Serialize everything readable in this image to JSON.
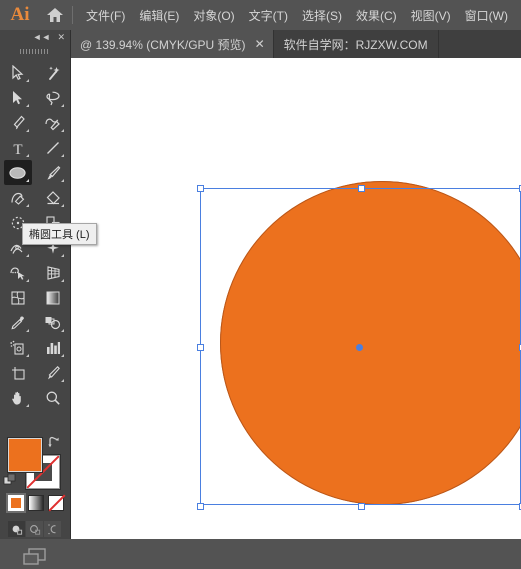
{
  "app": {
    "logo_text": "Ai",
    "home_icon": "home-icon",
    "accent_color": "#e98a3c",
    "shape_fill_color": "#ec711e",
    "selection_color": "#4a7fe0"
  },
  "menubar": {
    "items": [
      {
        "label": "文件(F)",
        "name": "menu-file"
      },
      {
        "label": "编辑(E)",
        "name": "menu-edit"
      },
      {
        "label": "对象(O)",
        "name": "menu-object"
      },
      {
        "label": "文字(T)",
        "name": "menu-type"
      },
      {
        "label": "选择(S)",
        "name": "menu-select"
      },
      {
        "label": "效果(C)",
        "name": "menu-effect"
      },
      {
        "label": "视图(V)",
        "name": "menu-view"
      },
      {
        "label": "窗口(W)",
        "name": "menu-window"
      }
    ]
  },
  "tabbar": {
    "document_tab": {
      "label": "@ 139.94% (CMYK/GPU 预览)",
      "zoom_level": "139.94%",
      "color_mode": "CMYK",
      "preview_mode": "GPU 预览",
      "close_label": "✕"
    },
    "watermark_tab": {
      "label": "软件自学网：RJZXW.COM"
    }
  },
  "toolpanel": {
    "collapse_label": "◄◄",
    "close_label": "✕",
    "tools": [
      {
        "name": "selection-tool",
        "icon": "arrow-cursor-icon"
      },
      {
        "name": "magic-wand-tool",
        "icon": "magic-wand-icon"
      },
      {
        "name": "direct-selection-tool",
        "icon": "direct-arrow-icon"
      },
      {
        "name": "lasso-tool",
        "icon": "lasso-icon"
      },
      {
        "name": "pen-tool",
        "icon": "pen-icon"
      },
      {
        "name": "curvature-tool",
        "icon": "curvature-icon"
      },
      {
        "name": "type-tool",
        "icon": "type-t-icon"
      },
      {
        "name": "line-segment-tool",
        "icon": "line-icon"
      },
      {
        "name": "ellipse-tool",
        "icon": "ellipse-icon"
      },
      {
        "name": "paintbrush-tool",
        "icon": "paintbrush-icon"
      },
      {
        "name": "shaper-tool",
        "icon": "shaper-icon"
      },
      {
        "name": "eraser-tool",
        "icon": "eraser-icon"
      },
      {
        "name": "rotate-tool",
        "icon": "rotate-icon"
      },
      {
        "name": "scale-tool",
        "icon": "scale-icon"
      },
      {
        "name": "width-tool",
        "icon": "width-icon"
      },
      {
        "name": "free-transform-tool",
        "icon": "free-transform-icon"
      },
      {
        "name": "shape-builder-tool",
        "icon": "shape-builder-icon"
      },
      {
        "name": "perspective-grid-tool",
        "icon": "perspective-grid-icon"
      },
      {
        "name": "mesh-tool",
        "icon": "mesh-icon"
      },
      {
        "name": "gradient-tool",
        "icon": "gradient-icon"
      },
      {
        "name": "eyedropper-tool",
        "icon": "eyedropper-icon"
      },
      {
        "name": "blend-tool",
        "icon": "blend-icon"
      },
      {
        "name": "symbol-sprayer-tool",
        "icon": "symbol-sprayer-icon"
      },
      {
        "name": "column-graph-tool",
        "icon": "bar-chart-icon"
      },
      {
        "name": "artboard-tool",
        "icon": "artboard-icon"
      },
      {
        "name": "slice-tool",
        "icon": "slice-knife-icon"
      },
      {
        "name": "hand-tool",
        "icon": "hand-icon"
      },
      {
        "name": "zoom-tool",
        "icon": "magnifier-icon"
      }
    ],
    "active_tool_index": 8,
    "tooltip": {
      "label": "椭圆工具 (L)",
      "shortcut": "L"
    },
    "color_controls": {
      "fill_label": "fill-swatch",
      "stroke_label": "stroke-swatch",
      "fill_color": "#ec711e",
      "stroke_color": "none",
      "swap_icon": "swap-fill-stroke-icon",
      "defaults_icon": "default-fill-stroke-icon",
      "fill_mode_buttons": [
        {
          "name": "color-button",
          "icon": "solid-color-icon"
        },
        {
          "name": "gradient-button",
          "icon": "gradient-icon"
        },
        {
          "name": "none-button",
          "icon": "none-slash-icon"
        }
      ],
      "drawing_modes": [
        {
          "name": "draw-normal-button",
          "icon": "draw-normal-icon"
        },
        {
          "name": "draw-behind-button",
          "icon": "draw-behind-icon"
        },
        {
          "name": "draw-inside-button",
          "icon": "draw-inside-icon"
        }
      ],
      "screen_mode": {
        "name": "change-screen-mode-button",
        "icon": "screen-mode-icon"
      }
    }
  },
  "canvas": {
    "shape": {
      "type": "ellipse",
      "fill": "#ec711e",
      "selected": true
    },
    "selection": {
      "handle_count": 8,
      "center_point": "anchor-center-point",
      "widget": "rotate-widget-icon"
    }
  }
}
